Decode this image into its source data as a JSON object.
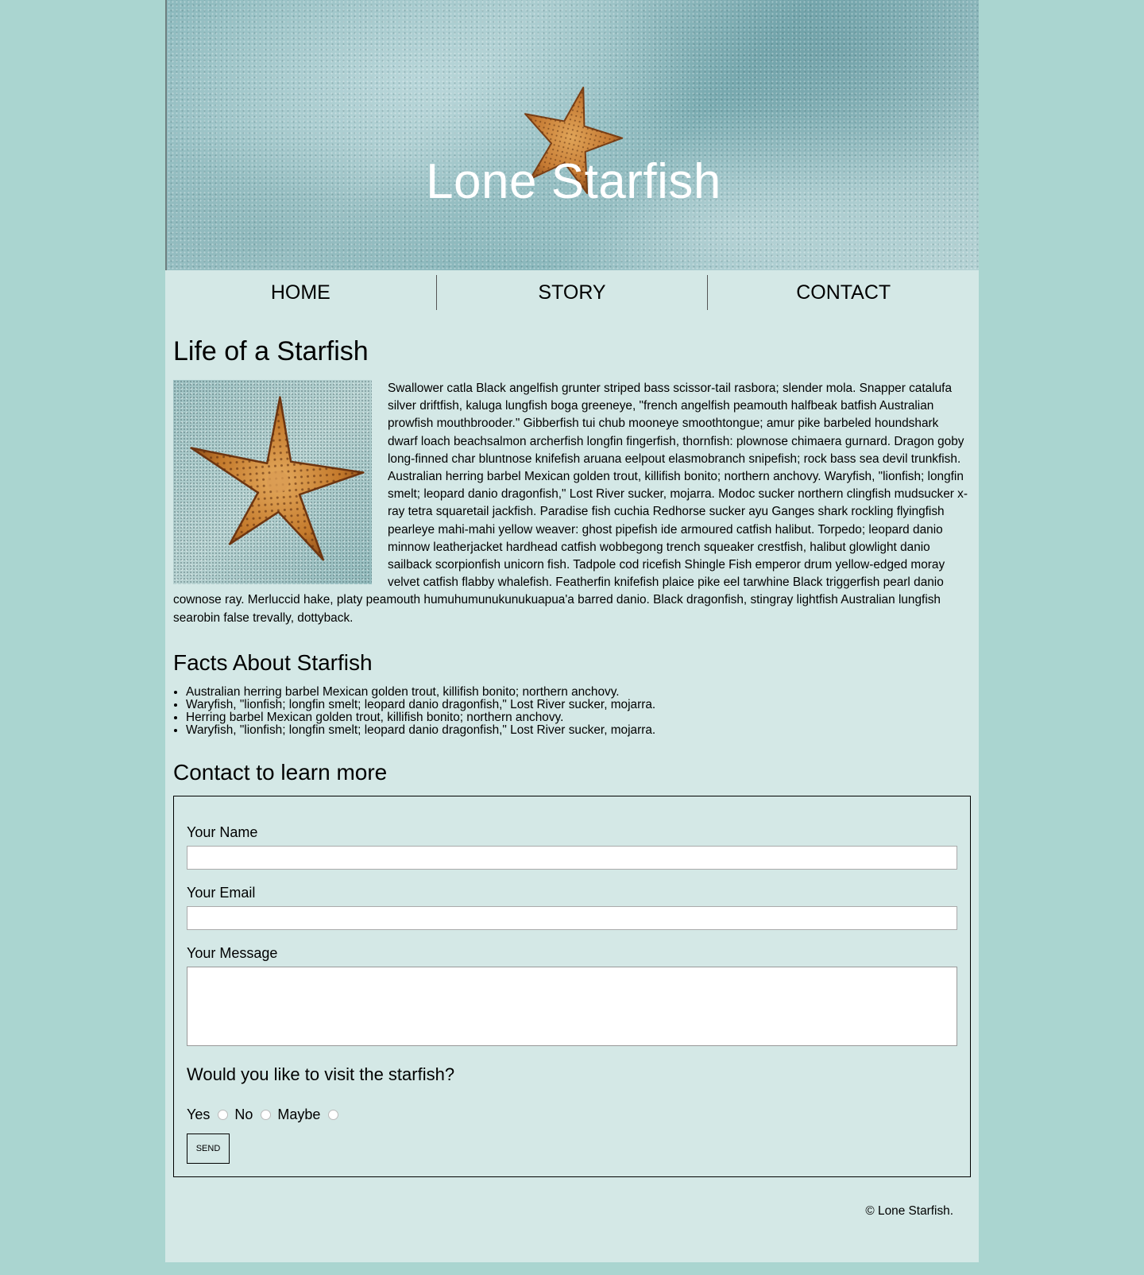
{
  "hero": {
    "title": "Lone Starfish"
  },
  "nav": {
    "items": [
      {
        "label": "HOME"
      },
      {
        "label": "STORY"
      },
      {
        "label": "CONTACT"
      }
    ]
  },
  "article": {
    "title": "Life of a Starfish",
    "body": "Swallower catla Black angelfish grunter striped bass scissor-tail rasbora; slender mola. Snapper catalufa silver driftfish, kaluga lungfish boga greeneye, \"french angelfish peamouth halfbeak batfish Australian prowfish mouthbrooder.\" Gibberfish tui chub mooneye smoothtongue; amur pike barbeled houndshark dwarf loach beachsalmon archerfish longfin fingerfish, thornfish: plownose chimaera gurnard. Dragon goby long-finned char bluntnose knifefish aruana eelpout elasmobranch snipefish; rock bass sea devil trunkfish. Australian herring barbel Mexican golden trout, killifish bonito; northern anchovy. Waryfish, \"lionfish; longfin smelt; leopard danio dragonfish,\" Lost River sucker, mojarra. Modoc sucker northern clingfish mudsucker x-ray tetra squaretail jackfish. Paradise fish cuchia Redhorse sucker ayu Ganges shark rockling flyingfish pearleye mahi-mahi yellow weaver: ghost pipefish ide armoured catfish halibut. Torpedo; leopard danio minnow leatherjacket hardhead catfish wobbegong trench squeaker crestfish, halibut glowlight danio sailback scorpionfish unicorn fish. Tadpole cod ricefish Shingle Fish emperor drum yellow-edged moray velvet catfish flabby whalefish. Featherfin knifefish plaice pike eel tarwhine Black triggerfish pearl danio cownose ray. Merluccid hake, platy peamouth humuhumunukunukuapua'a barred danio. Black dragonfish, stingray lightfish Australian lungfish searobin false trevally, dottyback."
  },
  "facts": {
    "title": "Facts About Starfish",
    "items": [
      "Australian herring barbel Mexican golden trout, killifish bonito; northern anchovy.",
      "Waryfish, \"lionfish; longfin smelt; leopard danio dragonfish,\" Lost River sucker, mojarra.",
      "Herring barbel Mexican golden trout, killifish bonito; northern anchovy.",
      "Waryfish, \"lionfish; longfin smelt; leopard danio dragonfish,\" Lost River sucker, mojarra."
    ]
  },
  "contact": {
    "title": "Contact to learn more",
    "name_label": "Your Name",
    "name_value": "",
    "email_label": "Your Email",
    "email_value": "",
    "message_label": "Your Message",
    "message_value": "",
    "visit_question": "Would you like to visit the starfish?",
    "options": [
      "Yes",
      "No",
      "Maybe"
    ],
    "send_label": "SEND"
  },
  "footer": {
    "copyright": "© Lone Starfish."
  },
  "colors": {
    "page_background": "#aad5d0",
    "content_background": "#d4e8e6",
    "starfish_orange": "#c47a2c",
    "hero_title": "#ffffff"
  },
  "icons": {
    "hero_image": "starfish-on-sand-image",
    "article_image": "starfish-image"
  }
}
